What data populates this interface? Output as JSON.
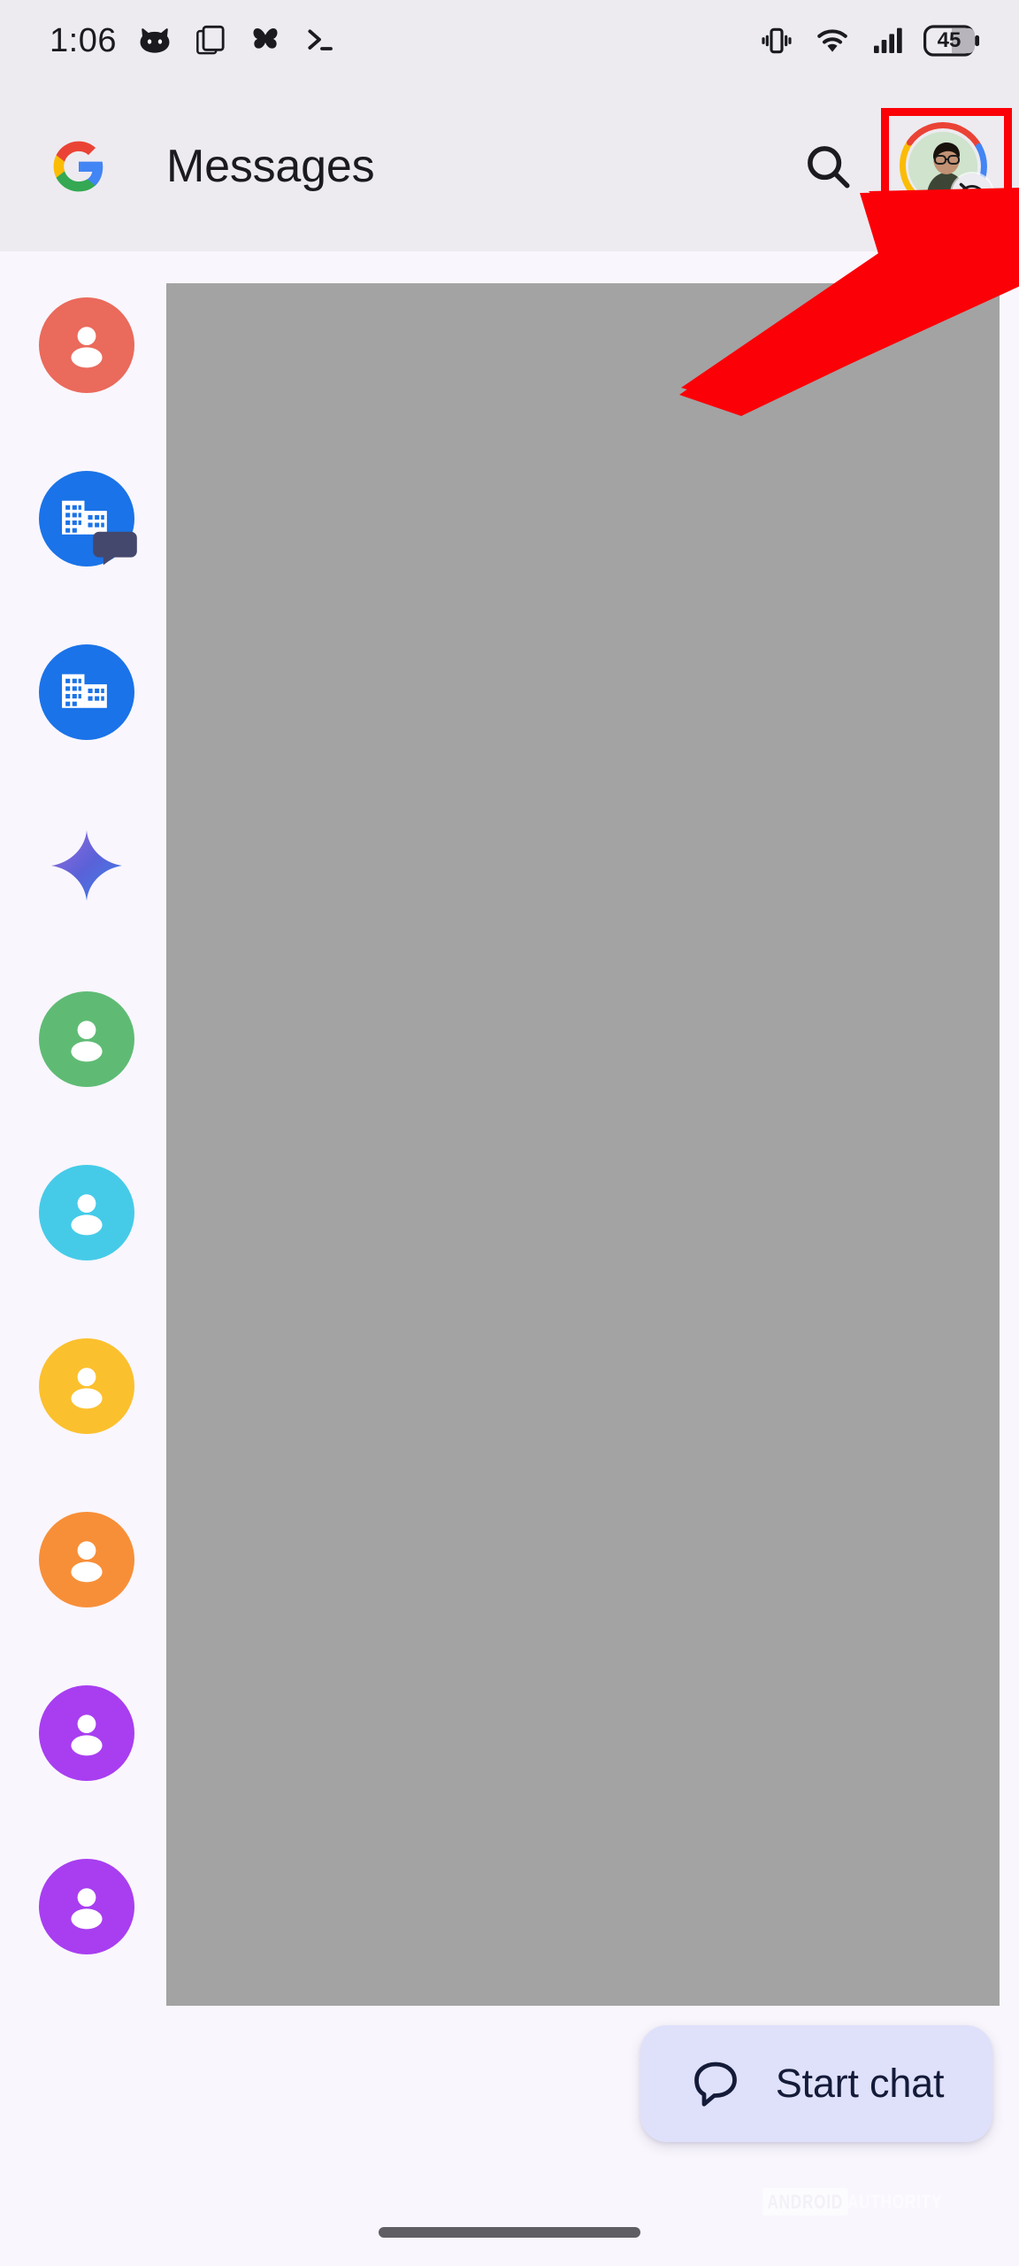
{
  "status_bar": {
    "clock": "1:06",
    "left_icons": [
      "cat-icon",
      "copy-icon",
      "butterfly-icon",
      "terminal-icon"
    ],
    "right_icons": [
      "vibrate-icon",
      "wifi-icon",
      "signal-icon"
    ],
    "battery_level": "45"
  },
  "app_bar": {
    "logo": "google-logo",
    "title": "Messages",
    "search_icon": "search-icon",
    "avatar": {
      "name": "account-avatar",
      "ring_colors": [
        "#ea4335",
        "#4285f4",
        "#34a853",
        "#fbbc05"
      ],
      "badge_icon": "visibility-off-icon"
    }
  },
  "highlight": {
    "color": "#fb0007",
    "target": "account-avatar"
  },
  "conversation_rail": {
    "items": [
      {
        "name": "contact-avatar-1",
        "icon": "person-icon",
        "color": "#ea6a5c"
      },
      {
        "name": "contact-avatar-2",
        "icon": "business-icon",
        "color": "#1a73e8",
        "badge": "chat-bubble-icon",
        "badge_color": "#44486d"
      },
      {
        "name": "contact-avatar-3",
        "icon": "business-icon",
        "color": "#1a73e8"
      },
      {
        "name": "gemini-avatar",
        "icon": "gemini-sparkle-icon",
        "color": "#4c66d7"
      },
      {
        "name": "contact-avatar-5",
        "icon": "person-icon",
        "color": "#5fbb74"
      },
      {
        "name": "contact-avatar-6",
        "icon": "person-icon",
        "color": "#45cbe8"
      },
      {
        "name": "contact-avatar-7",
        "icon": "person-icon",
        "color": "#fbc02d"
      },
      {
        "name": "contact-avatar-8",
        "icon": "person-icon",
        "color": "#f78f38"
      },
      {
        "name": "contact-avatar-9",
        "icon": "person-icon",
        "color": "#a83ef0"
      },
      {
        "name": "contact-avatar-10",
        "icon": "person-icon",
        "color": "#a83ef0"
      }
    ]
  },
  "content": {
    "placeholder_color": "#a3a3a3"
  },
  "fab": {
    "icon": "chat-bubble-icon",
    "label": "Start chat",
    "background": "#dfe1fb",
    "text_color": "#141b38"
  },
  "watermark": {
    "word_one": "ANDROID",
    "word_two": "AUTHORITY"
  },
  "nav": {
    "gesture_pill": "gesture-nav-pill"
  }
}
